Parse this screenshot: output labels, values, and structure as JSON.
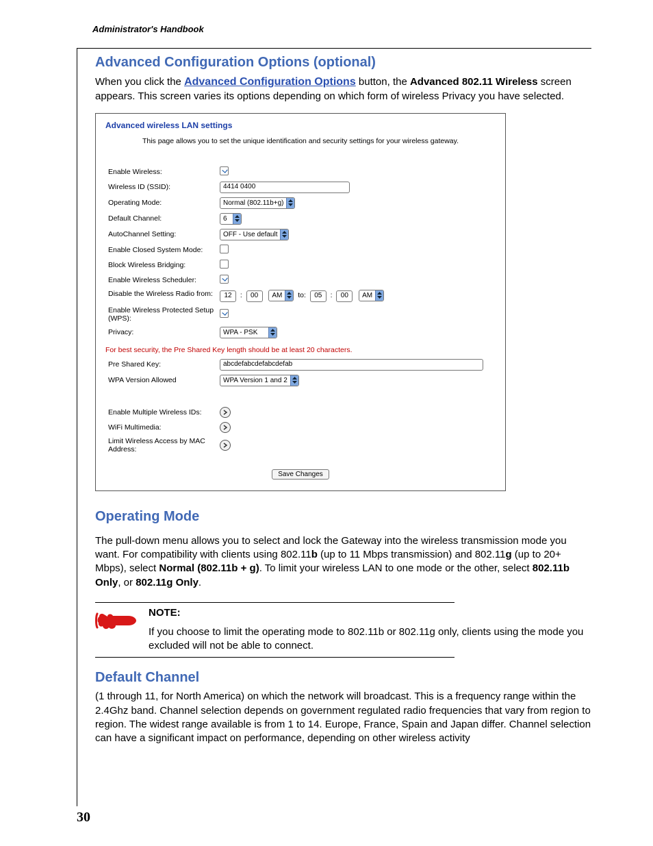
{
  "running_head": "Administrator's Handbook",
  "page_number": "30",
  "s1": {
    "title": "Advanced Configuration Options (optional)",
    "p1_pre": "When you click the ",
    "p1_link": "Advanced Configuration Options",
    "p1_mid": " button, the ",
    "p1_bold": "Advanced 802.11 Wireless",
    "p1_post": " screen appears. This screen varies its options depending on which form of wireless Privacy you have selected."
  },
  "panel": {
    "title": "Advanced wireless LAN settings",
    "desc": "This page allows you to set the unique identification and security settings for your wireless gateway.",
    "rows": {
      "enable_wireless": "Enable Wireless:",
      "ssid_label": "Wireless ID (SSID):",
      "ssid_value": "4414 0400",
      "op_mode_label": "Operating Mode:",
      "op_mode_value": "Normal (802.11b+g)",
      "default_channel_label": "Default Channel:",
      "default_channel_value": "6",
      "autochannel_label": "AutoChannel Setting:",
      "autochannel_value": "OFF - Use default",
      "closed_system_label": "Enable Closed System Mode:",
      "block_bridging_label": "Block Wireless Bridging:",
      "enable_scheduler_label": "Enable Wireless Scheduler:",
      "disable_radio_label": "Disable the Wireless Radio from:",
      "time_from_h": "12",
      "time_from_m": "00",
      "time_from_ap": "AM",
      "time_to_label": "to:",
      "time_to_h": "05",
      "time_to_m": "00",
      "time_to_ap": "AM",
      "wps_label": "Enable Wireless Protected Setup (WPS):",
      "privacy_label": "Privacy:",
      "privacy_value": "WPA - PSK",
      "warn": "For best security, the Pre Shared Key length should be at least 20 characters.",
      "psk_label": "Pre Shared Key:",
      "psk_value": "abcdefabcdefabcdefab",
      "wpa_ver_label": "WPA Version Allowed",
      "wpa_ver_value": "WPA Version 1 and 2",
      "multi_ids_label": "Enable Multiple Wireless IDs:",
      "wifi_mm_label": "WiFi Multimedia:",
      "mac_limit_label": "Limit Wireless Access by MAC Address:",
      "save": "Save Changes"
    }
  },
  "s2": {
    "title": "Operating Mode",
    "p_pre": "The pull-down menu allows you to select and lock the Gateway into the wireless transmission mode you want. For compatibility with clients using 802.11",
    "b1": "b",
    "p_mid1": " (up to 11 Mbps transmission) and 802.11",
    "b2": "g",
    "p_mid2": " (up to 20+ Mbps), select ",
    "bold_normal": "Normal (802.11b + g)",
    "p_mid3": ". To limit your wireless LAN to one mode or the other, select ",
    "bold_b_only": "802.11b Only",
    "p_or": ", or ",
    "bold_g_only": "802.11g Only",
    "p_end": "."
  },
  "note": {
    "label": "NOTE:",
    "text": "If you choose to limit the operating mode to 802.11b or 802.11g only, clients using the mode you excluded will not be able to connect."
  },
  "s3": {
    "title": "Default Channel",
    "p": "(1 through 11, for North America) on which the network will broadcast. This is a frequency range within the 2.4Ghz band. Channel selection depends on government regulated radio frequencies that vary from region to region. The widest range available is from 1 to 14. Europe, France, Spain and Japan differ. Channel selection can have a significant impact on performance, depending on other wireless activity"
  }
}
